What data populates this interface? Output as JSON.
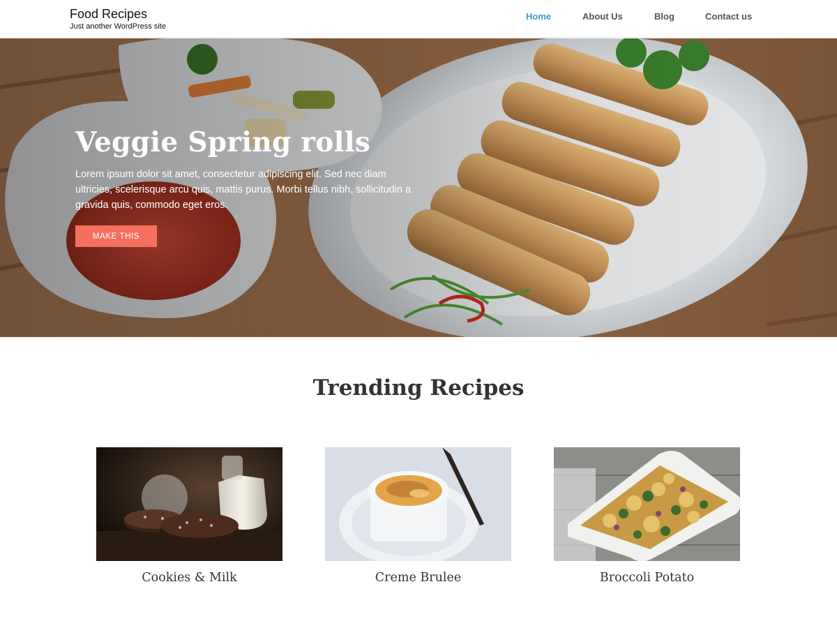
{
  "header": {
    "site_title": "Food Recipes",
    "tagline": "Just another WordPress site",
    "nav": [
      {
        "label": "Home",
        "active": true
      },
      {
        "label": "About Us",
        "active": false
      },
      {
        "label": "Blog",
        "active": false
      },
      {
        "label": "Contact us",
        "active": false
      }
    ],
    "nav_active_color": "#3a9bd9"
  },
  "hero": {
    "title": "Veggie Spring rolls",
    "text": "Lorem ipsum dolor sit amet, consectetur adipiscing elit. Sed nec diam ultricies, scelerisque arcu quis, mattis purus. Morbi tellus nibh, sollicitudin a gravida quis, commodo eget eros.",
    "button_label": "MAKE THIS",
    "button_color": "#f5705e",
    "image_icon": "spring-rolls-photo"
  },
  "trending": {
    "title": "Trending Recipes",
    "recipes": [
      {
        "title": "Cookies & Milk",
        "image_icon": "cookies-milk-photo"
      },
      {
        "title": "Creme Brulee",
        "image_icon": "creme-brulee-photo"
      },
      {
        "title": "Broccoli Potato",
        "image_icon": "broccoli-potato-photo"
      }
    ]
  }
}
